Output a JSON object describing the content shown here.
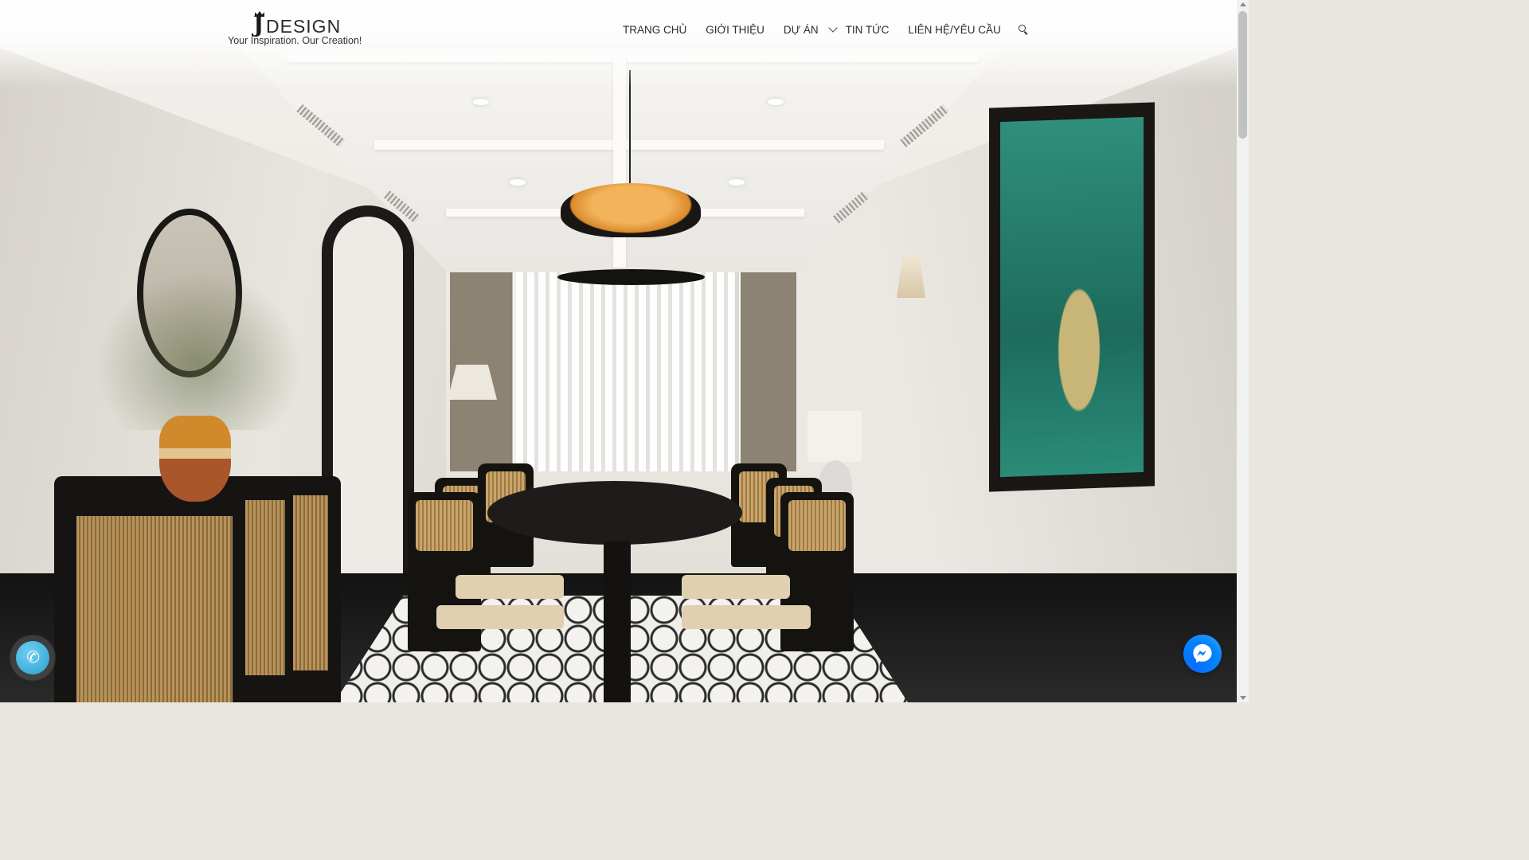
{
  "brand": {
    "logo_letter": "J",
    "logo_word": "DESIGN",
    "tagline": "Your Inspiration. Our Creation!"
  },
  "nav": {
    "items": [
      {
        "label": "TRANG CHỦ"
      },
      {
        "label": "GIỚI THIỆU"
      },
      {
        "label": "DỰ ÁN"
      },
      {
        "label": "TIN TỨC"
      },
      {
        "label": "LIÊN HỆ/YÊU CẦU"
      }
    ],
    "search_icon": "search-icon",
    "dropdown_icon": "chevron-down-icon"
  },
  "floating": {
    "call_icon": "phone-icon",
    "call_color": "#3db5e6",
    "messenger_icon": "messenger-icon",
    "messenger_color": "#0084ff"
  },
  "hero": {
    "image": "dining-room-interior-render"
  }
}
